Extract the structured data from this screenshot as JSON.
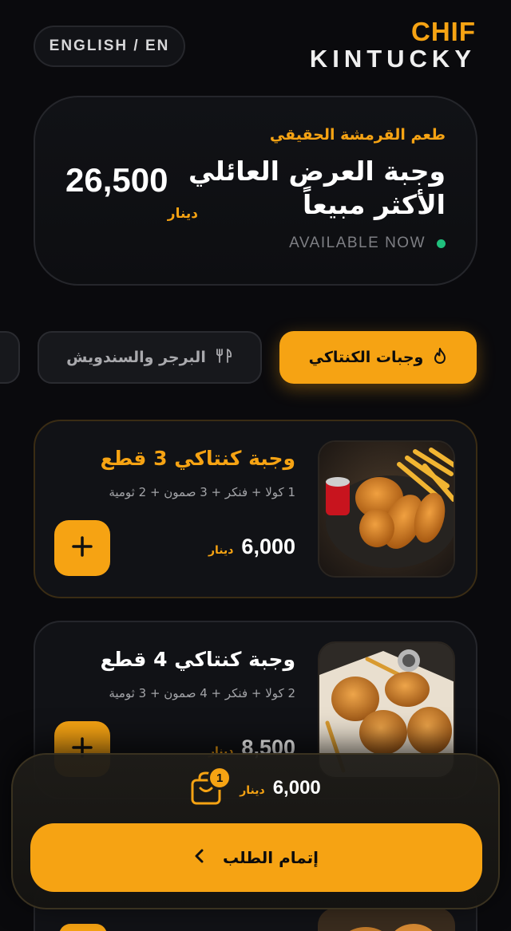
{
  "header": {
    "language_label": "ENGLISH / EN",
    "brand_top": "CHIF",
    "brand_bottom": "KINTUCKY"
  },
  "hero": {
    "tagline": "طعم القرمشة الحقيقي",
    "title": "وجبة العرض العائلي الأكثر مبيعاً",
    "status": "AVAILABLE NOW",
    "price": "26,500",
    "currency": "دينار"
  },
  "categories": [
    {
      "label": "وجبات الكنتاكي",
      "icon": "flame-icon",
      "active": true
    },
    {
      "label": "البرجر والسندويش",
      "icon": "fork-knife-icon",
      "active": false
    }
  ],
  "products": [
    {
      "title": "وجبة كنتاكي 3 قطع",
      "description": "1 كولا + فنكر + 3 صمون + 2 ثومية",
      "price": "6,000",
      "currency": "دينار"
    },
    {
      "title": "وجبة كنتاكي 4 قطع",
      "description": "2 كولا + فنكر + 4 صمون + 3 ثومية",
      "price": "8,500",
      "currency": "دينار"
    }
  ],
  "cart": {
    "total": "6,000",
    "currency": "دينار",
    "item_count": "1",
    "checkout_label": "إتمام الطلب"
  },
  "colors": {
    "accent": "#f6a313",
    "background": "#0a0a0d",
    "available_dot": "#20c07d"
  }
}
